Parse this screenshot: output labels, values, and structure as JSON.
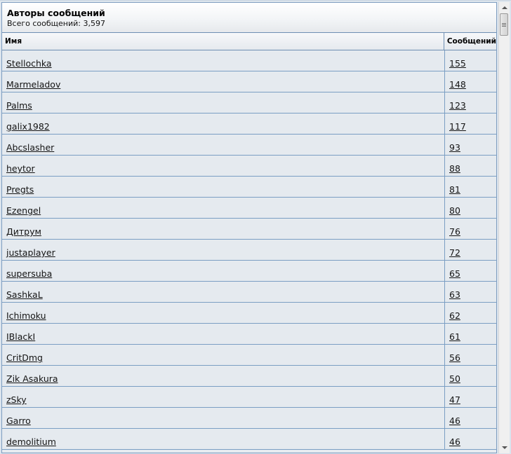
{
  "header": {
    "title": "Авторы сообщений",
    "subtitle": "Всего сообщений: 3,597"
  },
  "columns": {
    "name": "Имя",
    "count": "Сообщений"
  },
  "rows": [
    {
      "name": "Stellochka",
      "count": "155"
    },
    {
      "name": "Marmeladov",
      "count": "148"
    },
    {
      "name": "Palms",
      "count": "123"
    },
    {
      "name": "galix1982",
      "count": "117"
    },
    {
      "name": "Abcslasher",
      "count": "93"
    },
    {
      "name": "heytor",
      "count": "88"
    },
    {
      "name": "Pregts",
      "count": "81"
    },
    {
      "name": "Ezengel",
      "count": "80"
    },
    {
      "name": "Дитрум",
      "count": "76"
    },
    {
      "name": "justaplayer",
      "count": "72"
    },
    {
      "name": "supersuba",
      "count": "65"
    },
    {
      "name": "SashkaL",
      "count": "63"
    },
    {
      "name": "Ichimoku",
      "count": "62"
    },
    {
      "name": "IBlackI",
      "count": "61"
    },
    {
      "name": "CritDmg",
      "count": "56"
    },
    {
      "name": "Zik Asakura",
      "count": "50"
    },
    {
      "name": "zSky",
      "count": "47"
    },
    {
      "name": "Garro",
      "count": "46"
    },
    {
      "name": "demolitium",
      "count": "46"
    }
  ],
  "icons": {
    "scroll_up": "scroll-up-arrow-icon",
    "scroll_down": "scroll-down-arrow-icon"
  }
}
